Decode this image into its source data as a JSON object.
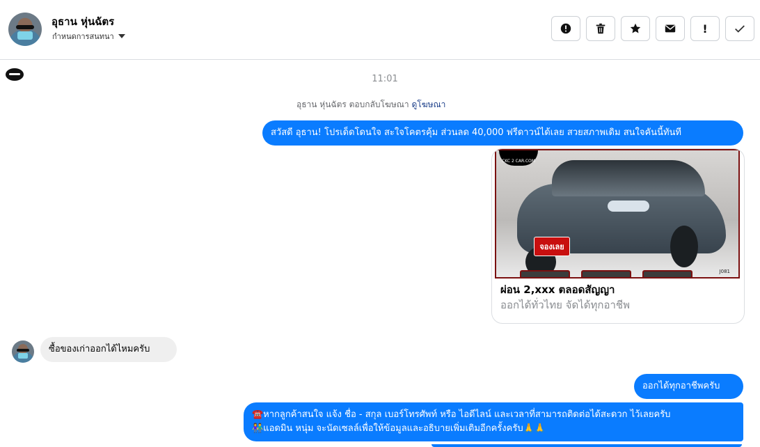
{
  "header": {
    "name": "อุธาน หุ่นฉัตร",
    "subtitle": "กำหนดการสนทนา",
    "actions": [
      {
        "name": "report-button",
        "icon": "alert-circle-icon"
      },
      {
        "name": "delete-button",
        "icon": "trash-icon"
      },
      {
        "name": "star-button",
        "icon": "star-icon"
      },
      {
        "name": "mark-unread-button",
        "icon": "envelope-icon"
      },
      {
        "name": "important-button",
        "icon": "exclamation-icon",
        "label": "!"
      },
      {
        "name": "done-button",
        "icon": "check-icon"
      }
    ]
  },
  "thread": {
    "time": "11:01",
    "notice_text": "อุธาน หุ่นฉัตร ตอบกลับโฆษณา",
    "notice_link": "ดูโฆษณา",
    "ad_message": "สวัสดี อุธาน! โปรเด็ดโดนใจ สะใจโคตรคุ้ม ส่วนลด 40,000 ฟรีดาวน์ได้เลย สวยสภาพเดิม สนใจคันนี้ทันที",
    "card": {
      "title": "ผ่อน 2,xxx ตลอดสัญญา",
      "subtitle": "ออกได้ทั่วไทย จัดได้ทุกอาชีพ",
      "stamp": "จองเลย",
      "brand": "CKC 2 CAR.COM",
      "code": "J081"
    },
    "incoming_message": "ซื้อของเก่าออกได้ไหมครับ",
    "reply_short": "ออกได้ทุกอาชีพครับ",
    "reply_long_line1": "☎️หากลูกค้าสนใจ แจ้ง ชื่อ - สกุล เบอร์โทรศัพท์ หรือ ไอดีไลน์ และเวลาที่สามารถติดต่อได้สะดวก ไว้เลยครับ",
    "reply_long_line2": "👫แอดมิน หนุ่ม จะนัดเซลล์เพื่อให้ข้อมูลและอธิบายเพิ่มเติมอีกครั้งครับ🙏🙏"
  },
  "colors": {
    "accent": "#0a7cff",
    "incoming_bubble": "#efefef",
    "link": "#1c3f8a"
  }
}
